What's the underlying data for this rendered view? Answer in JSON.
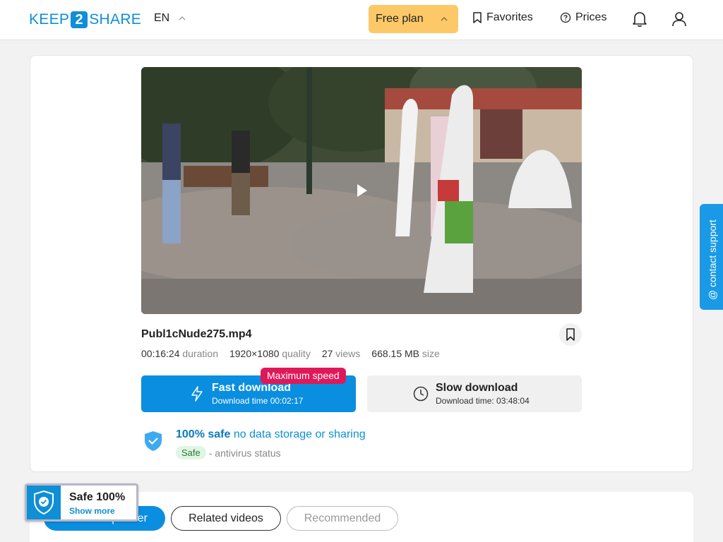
{
  "header": {
    "logo": {
      "pre": "KEEP",
      "mid": "2",
      "post": "SHARE"
    },
    "language": "EN",
    "plan_label": "Free plan",
    "favorites_label": "Favorites",
    "prices_label": "Prices"
  },
  "file": {
    "name": "Publ1cNude275.mp4",
    "duration": "00:16:24",
    "duration_label": "duration",
    "resolution": "1920×1080",
    "quality_label": "quality",
    "views": "27",
    "views_label": "views",
    "size": "668.15 MB",
    "size_label": "size"
  },
  "fast_download": {
    "title": "Fast download",
    "subtitle": "Download time 00:02:17",
    "badge": "Maximum speed"
  },
  "slow_download": {
    "title": "Slow download",
    "subtitle": "Download time: 03:48:04"
  },
  "safety": {
    "headline": "100% safe",
    "text": "no data storage or sharing",
    "status_pill": "Safe",
    "status_text": "- antivirus status"
  },
  "support": {
    "label": "@ contact support"
  },
  "tabs": [
    {
      "label": "From this partner",
      "active": true
    },
    {
      "label": "Related videos",
      "active": false
    },
    {
      "label": "Recommended",
      "active": false
    }
  ],
  "safe_badge": {
    "title": "Safe 100%",
    "link": "Show more"
  },
  "colors": {
    "accent": "#0a8ee0",
    "plan": "#fcc868",
    "max_speed": "#e0185a"
  }
}
